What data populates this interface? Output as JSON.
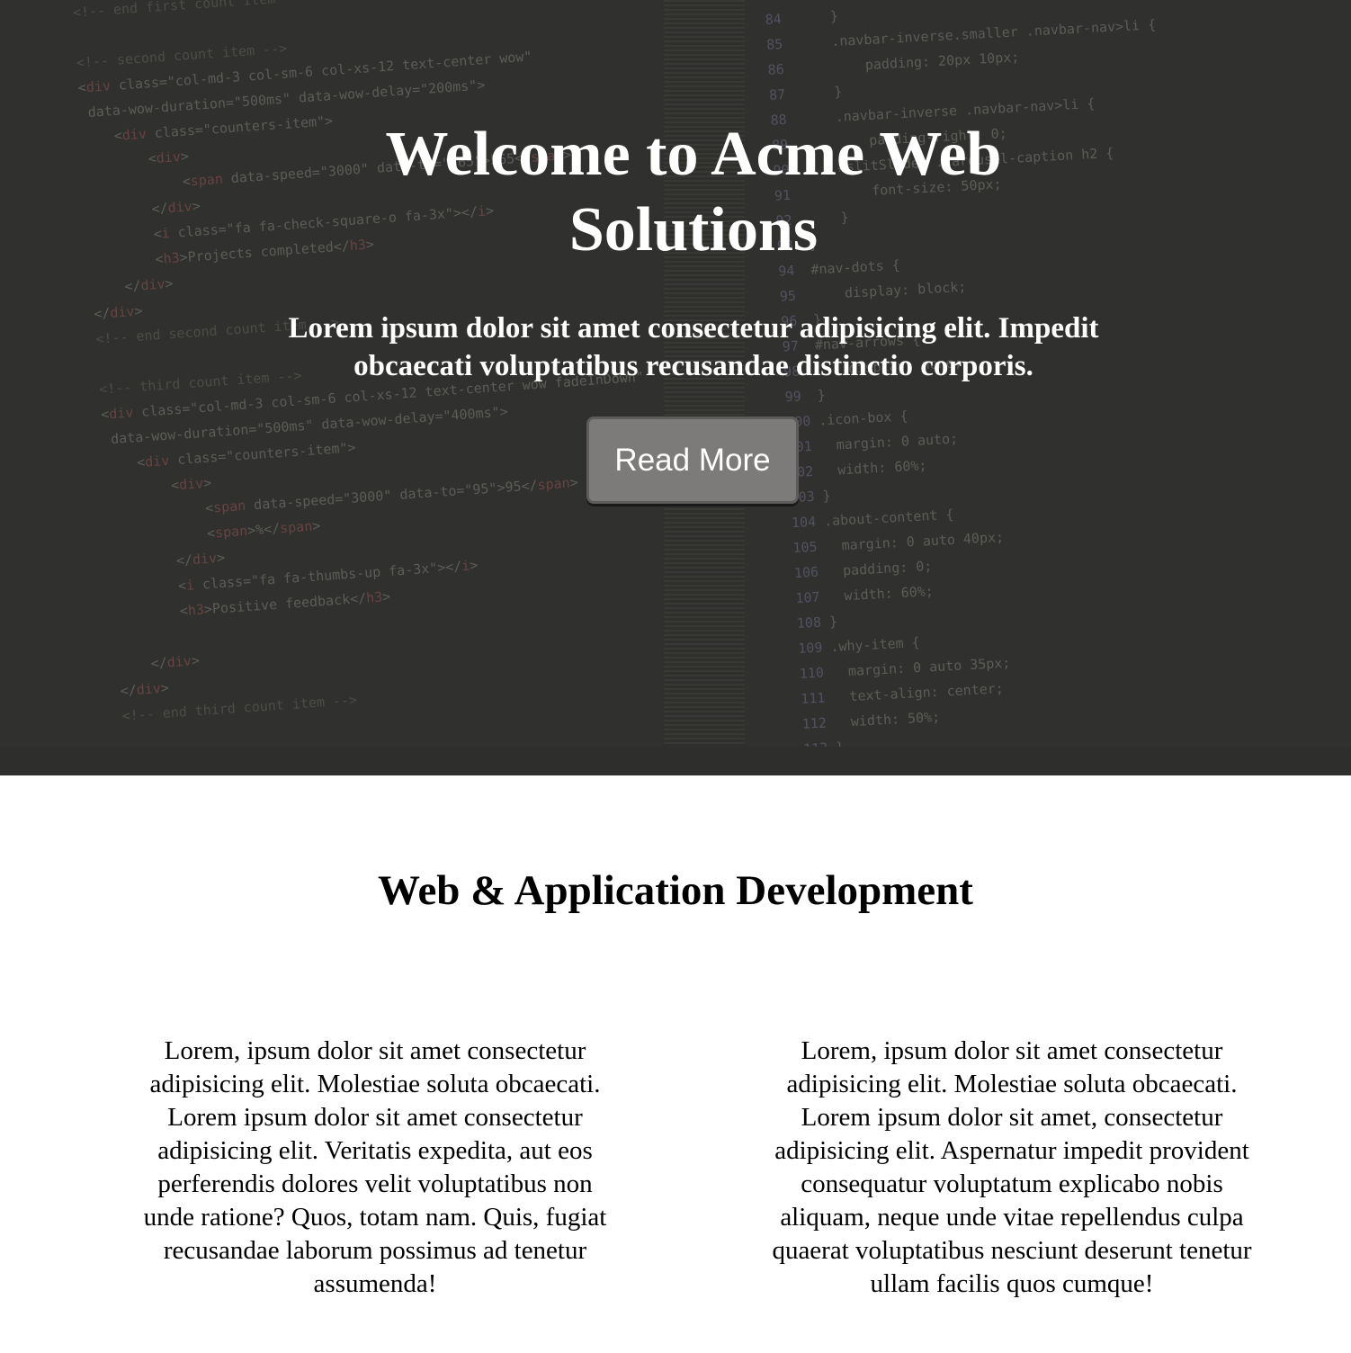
{
  "hero": {
    "title": "Welcome to Acme Web Solutions",
    "subtitle": "Lorem ipsum dolor sit amet consectetur adipisicing elit. Impedit obcaecati voluptatibus recusandae distinctio corporis.",
    "button_label": "Read More",
    "background_color": "#2e2e2c",
    "button_color": "#7d7b79"
  },
  "section": {
    "title": "Web & Application Development",
    "columns": [
      {
        "text": "Lorem, ipsum dolor sit amet consectetur adipisicing elit. Molestiae soluta obcaecati. Lorem ipsum dolor sit amet consectetur adipisicing elit. Veritatis expedita, aut eos perferendis dolores velit voluptatibus non unde ratione? Quos, totam nam. Quis, fugiat recusandae laborum possimus ad tenetur assumenda!"
      },
      {
        "text": "Lorem, ipsum dolor sit amet consectetur adipisicing elit. Molestiae soluta obcaecati. Lorem ipsum dolor sit amet, consectetur adipisicing elit. Aspernatur impedit provident consequatur voluptatum explicabo nobis aliquam, neque unde vitae repellendus culpa quaerat voluptatibus nesciunt deserunt tenetur ullam facilis quos cumque!"
      }
    ]
  }
}
